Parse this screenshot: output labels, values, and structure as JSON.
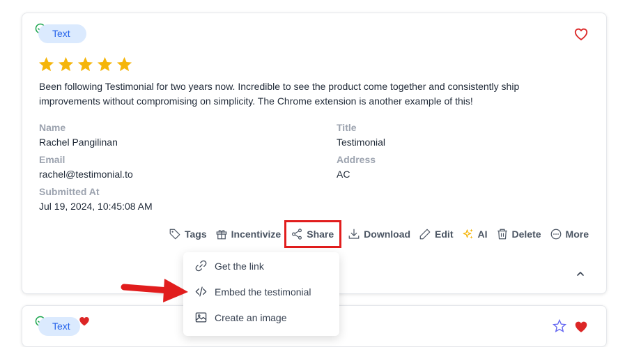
{
  "card": {
    "type_badge": "Text",
    "rating": 5,
    "testimonial_text": "Been following Testimonial for two years now. Incredible to see the product come together and consistently ship improvements without compromising on simplicity. The Chrome extension is another example of this!",
    "fields": {
      "name_label": "Name",
      "name_value": "Rachel Pangilinan",
      "title_label": "Title",
      "title_value": "Testimonial",
      "email_label": "Email",
      "email_value": "rachel@testimonial.to",
      "address_label": "Address",
      "address_value": "AC",
      "submitted_label": "Submitted At",
      "submitted_value": "Jul 19, 2024, 10:45:08 AM"
    },
    "actions": {
      "tags": "Tags",
      "incentivize": "Incentivize",
      "share": "Share",
      "download": "Download",
      "edit": "Edit",
      "ai": "AI",
      "delete": "Delete",
      "more": "More"
    }
  },
  "share_menu": {
    "items": [
      {
        "label": "Get the link",
        "icon": "link-icon"
      },
      {
        "label": "Embed the testimonial",
        "icon": "code-icon"
      },
      {
        "label": "Create an image",
        "icon": "image-icon"
      }
    ]
  },
  "card2": {
    "type_badge": "Text"
  },
  "colors": {
    "accent_red": "#e11d1d",
    "heart_red": "#dc2626",
    "star_gold": "#f5b50a",
    "badge_bg": "#dbeafe",
    "badge_text": "#2563eb",
    "check_green": "#16a34a",
    "ai_gold": "#f5b50a"
  }
}
